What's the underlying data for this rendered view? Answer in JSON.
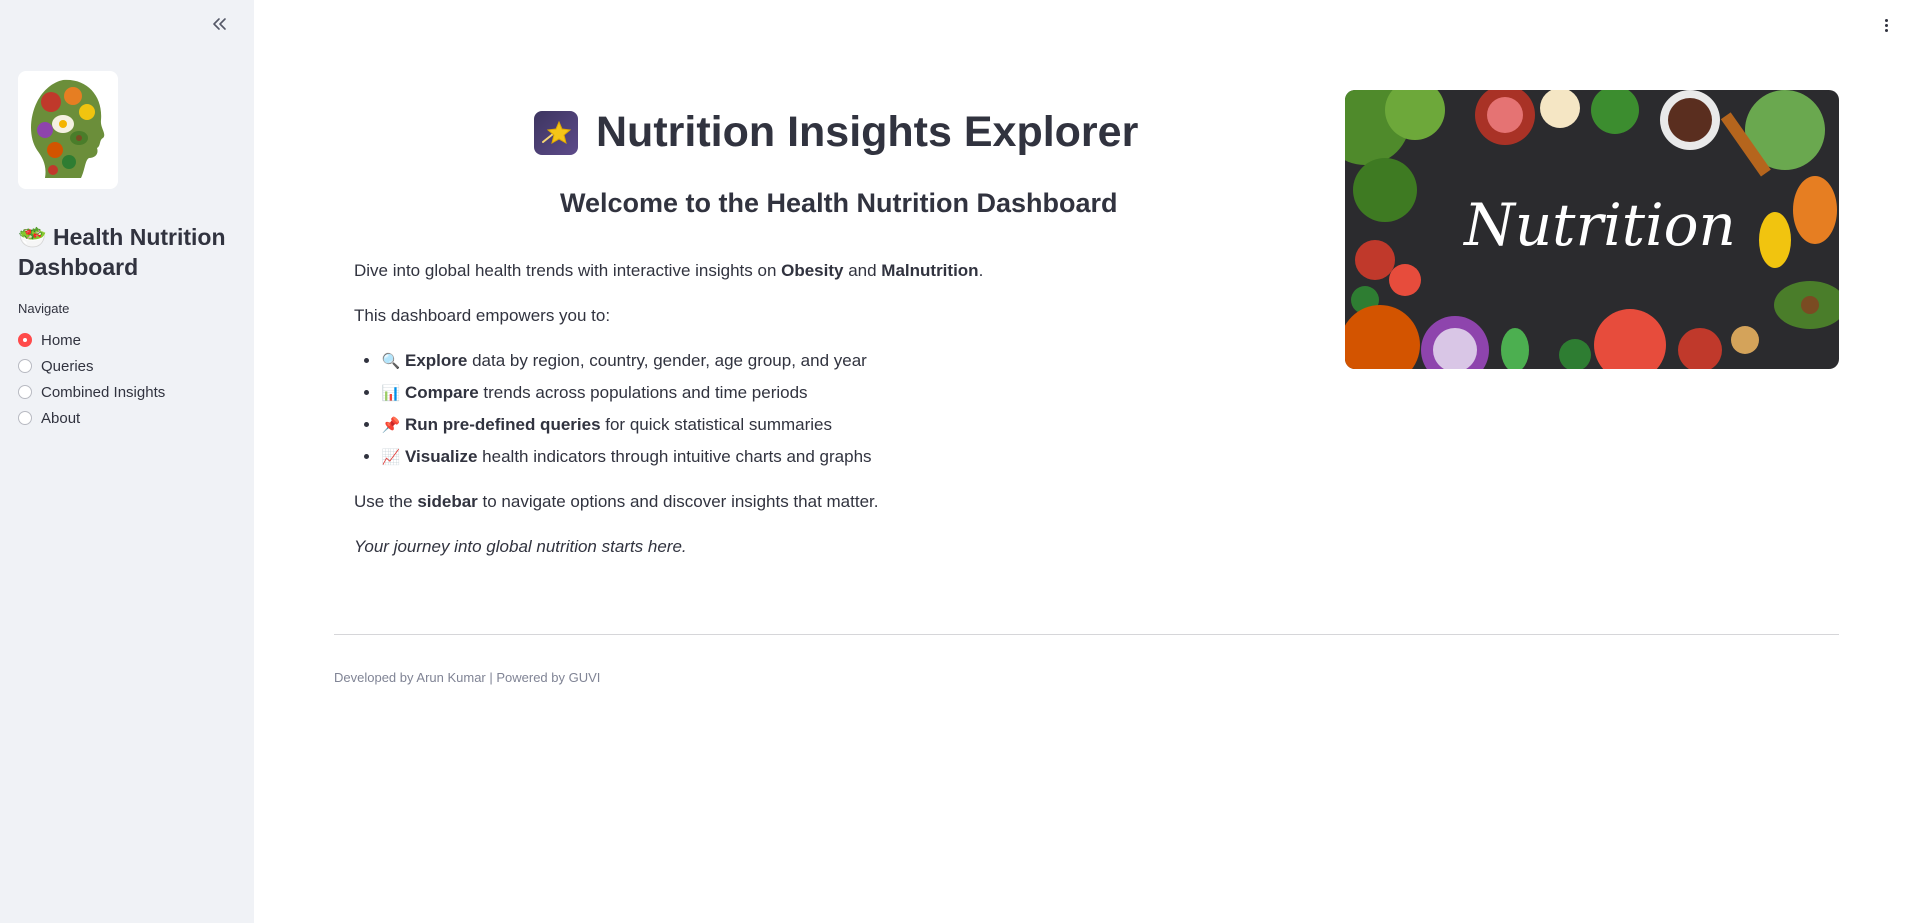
{
  "sidebar": {
    "logo_alt": "Healthy food head logo",
    "title": "🥗 Health Nutrition Dashboard",
    "nav_label": "Navigate",
    "nav_items": [
      {
        "label": "Home",
        "selected": true
      },
      {
        "label": "Queries",
        "selected": false
      },
      {
        "label": "Combined Insights",
        "selected": false
      },
      {
        "label": "About",
        "selected": false
      }
    ]
  },
  "main": {
    "title": "Nutrition Insights Explorer",
    "title_icon": "shooting-star-icon",
    "subtitle": "Welcome to the Health Nutrition Dashboard",
    "intro_prefix": "Dive into global health trends with interactive insights on ",
    "intro_bold1": "Obesity",
    "intro_and": " and ",
    "intro_bold2": "Malnutrition",
    "intro_suffix": ".",
    "empower": "This dashboard empowers you to:",
    "bullets": [
      {
        "emoji": "🔍",
        "icon": "magnifier-icon",
        "bold": "Explore",
        "text": " data by region, country, gender, age group, and year"
      },
      {
        "emoji": "📊",
        "icon": "bar-chart-icon",
        "bold": "Compare",
        "text": " trends across populations and time periods"
      },
      {
        "emoji": "📌",
        "icon": "pushpin-icon",
        "bold": "Run pre-defined queries",
        "text": " for quick statistical summaries"
      },
      {
        "emoji": "📈",
        "icon": "trend-chart-icon",
        "bold": "Visualize",
        "text": " health indicators through intuitive charts and graphs"
      }
    ],
    "use_prefix": "Use the ",
    "use_bold": "sidebar",
    "use_suffix": " to navigate options and discover insights that matter.",
    "closing": "Your journey into global nutrition starts here.",
    "banner_text": "Nutrition"
  },
  "footer": {
    "text": "Developed by Arun Kumar | Powered by GUVI"
  },
  "colors": {
    "sidebar_bg": "#f0f2f6",
    "accent": "#ff4b4b",
    "text": "#31333f",
    "footer_text": "#808495"
  }
}
